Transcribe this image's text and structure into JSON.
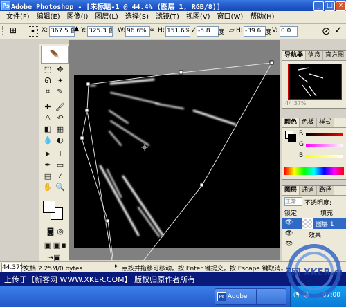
{
  "window": {
    "title": "Adobe Photoshop - [未标题-1 @ 44.4% (图层 1, RGB/8)]"
  },
  "menu": [
    "文件(F)",
    "编辑(E)",
    "图像(I)",
    "图层(L)",
    "选择(S)",
    "滤镜(T)",
    "视图(V)",
    "窗口(W)",
    "帮助(H)"
  ],
  "options": {
    "x_label": "X:",
    "x_value": "367.5 像",
    "y_label": "Y:",
    "y_value": "325.3 像",
    "w_label": "W:",
    "w_value": "96.6%",
    "h_label": "H:",
    "h_value": "151.6%",
    "angle_value": "-5.8",
    "angle_unit": "度",
    "hskew_label": "H:",
    "hskew_value": "-39.6",
    "hskew_unit": "度",
    "vskew_label": "V:",
    "vskew_value": "0.0"
  },
  "panels": {
    "navigator_tabs": [
      "导航器",
      "信息",
      "直方图"
    ],
    "navigator_zoom": "44.37%",
    "color_tabs": [
      "颜色",
      "色板",
      "样式"
    ],
    "color_labels": [
      "R",
      "G",
      "B"
    ],
    "layers_tabs": [
      "图层",
      "通道",
      "路径"
    ],
    "blend_mode": "正常",
    "opacity_label": "不透明度:",
    "lock_label": "锁定:",
    "fill_label": "填充:",
    "layer_name": "图层 1",
    "effect_label": "效果"
  },
  "status": {
    "zoom": "44.37%",
    "doc": "文档:2.25M/0 bytes",
    "hint": "点按并拖移可移动。按 Enter 键提交。按 Escape 键取消。用空格键"
  },
  "banner": {
    "text": "上传于【新客网 WWW.XKER.COM】 版权归原作者所有"
  },
  "taskbar": {
    "app_button": "Adobe",
    "time": "07:00"
  },
  "watermark": {
    "text": "新客网 XKER.com"
  }
}
